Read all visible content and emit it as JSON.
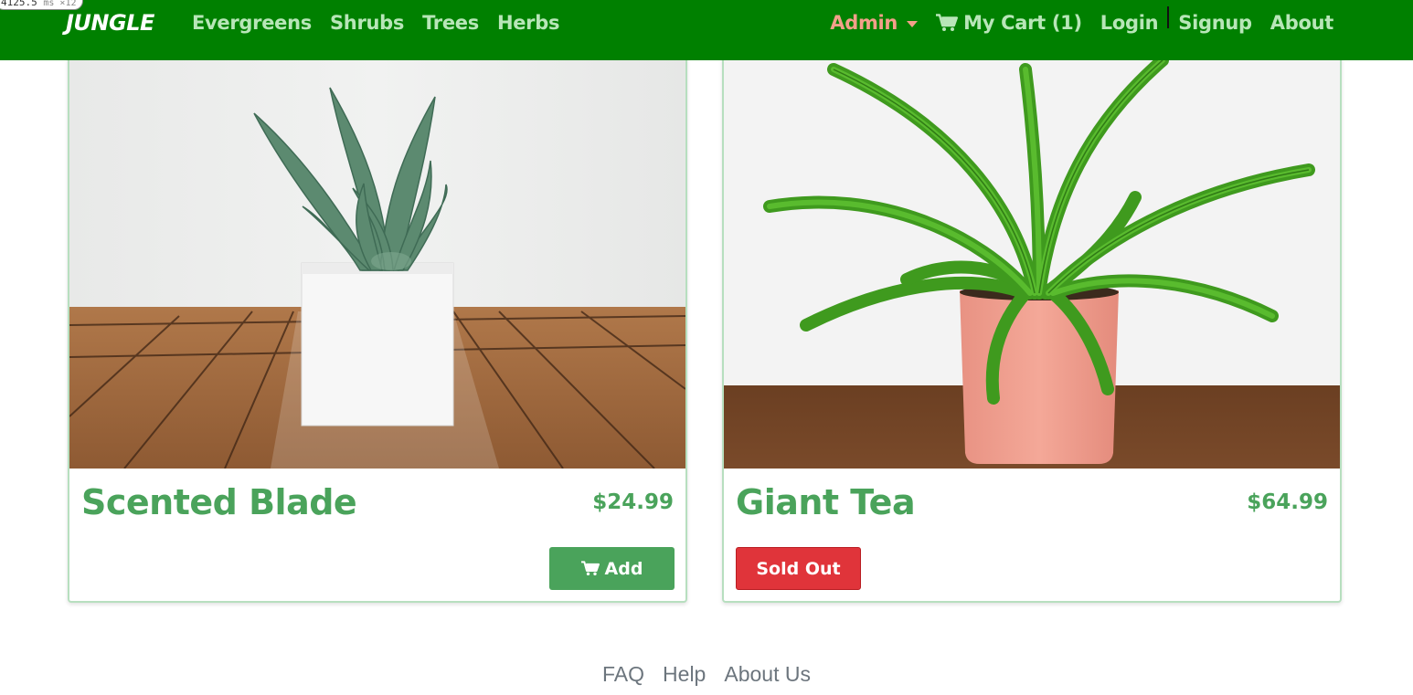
{
  "perf_badge": {
    "value": "4125.5",
    "unit": "ms ×12"
  },
  "navbar": {
    "brand": "JUNGLE",
    "left_links": [
      "Evergreens",
      "Shrubs",
      "Trees",
      "Herbs"
    ],
    "admin": "Admin",
    "cart": "My Cart (1)",
    "login": "Login",
    "signup": "Signup",
    "about": "About",
    "colors": {
      "background": "#008000",
      "link": "#b8e6b8",
      "admin": "#f3a08a"
    }
  },
  "products": [
    {
      "name": "Scented Blade",
      "price": "$24.99",
      "action": "Add",
      "action_type": "add",
      "image": "succulent-in-white-pot"
    },
    {
      "name": "Giant Tea",
      "price": "$64.99",
      "action": "Sold Out",
      "action_type": "sold-out",
      "image": "fern-in-pink-pot"
    }
  ],
  "footer": {
    "links": [
      "FAQ",
      "Help",
      "About Us"
    ]
  },
  "colors": {
    "accent": "#4aa35b",
    "sold_out": "#e0343a",
    "card_border": "#b7dfbf"
  }
}
